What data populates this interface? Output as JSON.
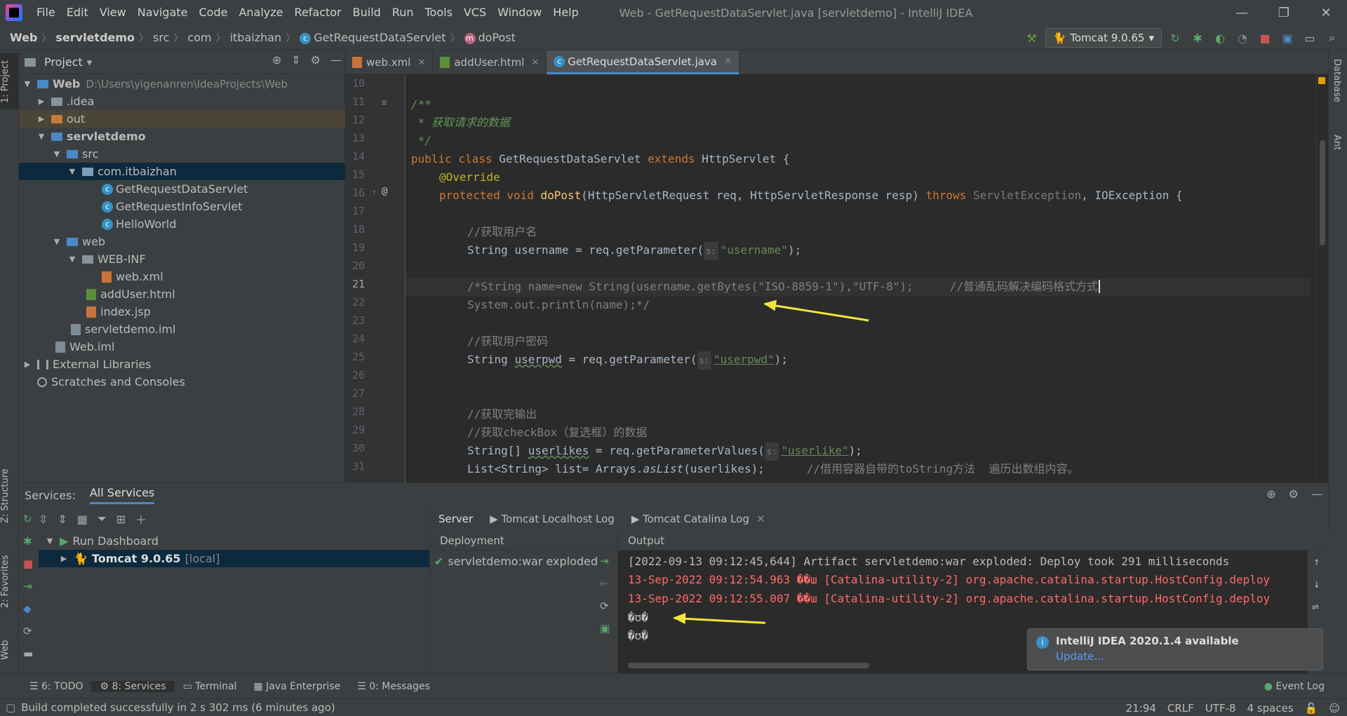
{
  "menubar": {
    "items": [
      "File",
      "Edit",
      "View",
      "Navigate",
      "Code",
      "Analyze",
      "Refactor",
      "Build",
      "Run",
      "Tools",
      "VCS",
      "Window",
      "Help"
    ],
    "title": "Web - GetRequestDataServlet.java [servletdemo] - IntelliJ IDEA"
  },
  "breadcrumb": {
    "items": [
      "Web",
      "servletdemo",
      "src",
      "com",
      "itbaizhan",
      "GetRequestDataServlet",
      "doPost"
    ]
  },
  "run_config": "Tomcat 9.0.65",
  "project": {
    "title": "Project",
    "tree": [
      {
        "label": "Web",
        "hint": "D:\\Users\\yigenanren\\IdeaProjects\\Web"
      },
      {
        "label": ".idea"
      },
      {
        "label": "out"
      },
      {
        "label": "servletdemo"
      },
      {
        "label": "src"
      },
      {
        "label": "com.itbaizhan"
      },
      {
        "label": "GetRequestDataServlet"
      },
      {
        "label": "GetRequestInfoServlet"
      },
      {
        "label": "HelloWorld"
      },
      {
        "label": "web"
      },
      {
        "label": "WEB-INF"
      },
      {
        "label": "web.xml"
      },
      {
        "label": "addUser.html"
      },
      {
        "label": "index.jsp"
      },
      {
        "label": "servletdemo.iml"
      },
      {
        "label": "Web.iml"
      },
      {
        "label": "External Libraries"
      },
      {
        "label": "Scratches and Consoles"
      }
    ]
  },
  "tabs": [
    "web.xml",
    "addUser.html",
    "GetRequestDataServlet.java"
  ],
  "left_strip": [
    "1: Project",
    "Z: Structure",
    "2: Favorites",
    "Web"
  ],
  "right_strip": [
    "Database",
    "Ant"
  ],
  "editor": {
    "line_numbers": [
      "10",
      "11",
      "12",
      "13",
      "14",
      "15",
      "16",
      "17",
      "18",
      "19",
      "20",
      "21",
      "22",
      "23",
      "24",
      "25",
      "26",
      "27",
      "28",
      "29",
      "30",
      "31"
    ],
    "lines": {
      "l11": "/**",
      "l12": " * 获取请求的数据",
      "l13": " */",
      "l14a": "public class ",
      "l14b": "GetRequestDataServlet ",
      "l14c": "extends ",
      "l14d": "HttpServlet {",
      "l15": "@Override",
      "l16a": "protected void ",
      "l16b": "doPost",
      "l16c": "(HttpServletRequest req, HttpServletResponse resp) ",
      "l16d": "throws ",
      "l16e": "ServletException",
      "l16f": ", IOException {",
      "l18": "//获取用户名",
      "l19a": "String username = req.getParameter(",
      "l19h": "s:",
      "l19s": "\"username\"",
      "l19z": ");",
      "l21a": "/*String name=new String(username.getBytes(\"ISO-8859-1\"),\"UTF-8\");",
      "l21b": "//普通乱码解决编码格式方式",
      "l22": "System.out.println(name);*/",
      "l24": "//获取用户密码",
      "l25a": "String ",
      "l25b": "userpwd",
      "l25c": " = req.getParameter(",
      "l25h": "s:",
      "l25s": "\"userpwd\"",
      "l25z": ");",
      "l28": "//获取完输出",
      "l29": "//获取checkBox（复选框）的数据",
      "l30a": "String[] ",
      "l30b": "userlikes",
      "l30c": " = req.getParameterValues(",
      "l30h": "s:",
      "l30s": "\"userlike\"",
      "l30z": ");",
      "l31a": "List<String> list= Arrays.",
      "l31b": "asList",
      "l31c": "(userlikes);",
      "l31d": "//借用容器自带的toString方法  遍历出数组内容。"
    }
  },
  "services": {
    "label": "Services:",
    "tab": "All Services",
    "tree": [
      {
        "label": "Run Dashboard"
      },
      {
        "label": "Tomcat 9.0.65",
        "hint": "[local]"
      }
    ],
    "server_tabs": [
      "Server",
      "Tomcat Localhost Log",
      "Tomcat Catalina Log"
    ],
    "deployment_header": "Deployment",
    "deployment_item": "servletdemo:war exploded",
    "output_header": "Output",
    "output": [
      "[2022-09-13 09:12:45,644] Artifact servletdemo:war exploded: Deploy took 291 milliseconds",
      "13-Sep-2022 09:12:54.963 ��ш [Catalina-utility-2] org.apache.catalina.startup.HostConfig.deploy",
      "13-Sep-2022 09:12:55.007 ��ш [Catalina-utility-2] org.apache.catalina.startup.HostConfig.deploy",
      "�ʊ�",
      "�ʊ�"
    ]
  },
  "notification": {
    "title": "IntelliJ IDEA 2020.1.4 available",
    "link": "Update..."
  },
  "bottom_tools": [
    "6: TODO",
    "8: Services",
    "Terminal",
    "Java Enterprise",
    "0: Messages",
    "Event Log"
  ],
  "status": {
    "message": "Build completed successfully in 2 s 302 ms (6 minutes ago)",
    "position": "21:94",
    "line_sep": "CRLF",
    "encoding": "UTF-8",
    "indent": "4 spaces"
  },
  "colors": {
    "background": "#2b2b2b",
    "panel": "#3c3f41",
    "selection": "#0d293e",
    "accent": "#4a88c7",
    "error_output": "#ff6b68"
  }
}
